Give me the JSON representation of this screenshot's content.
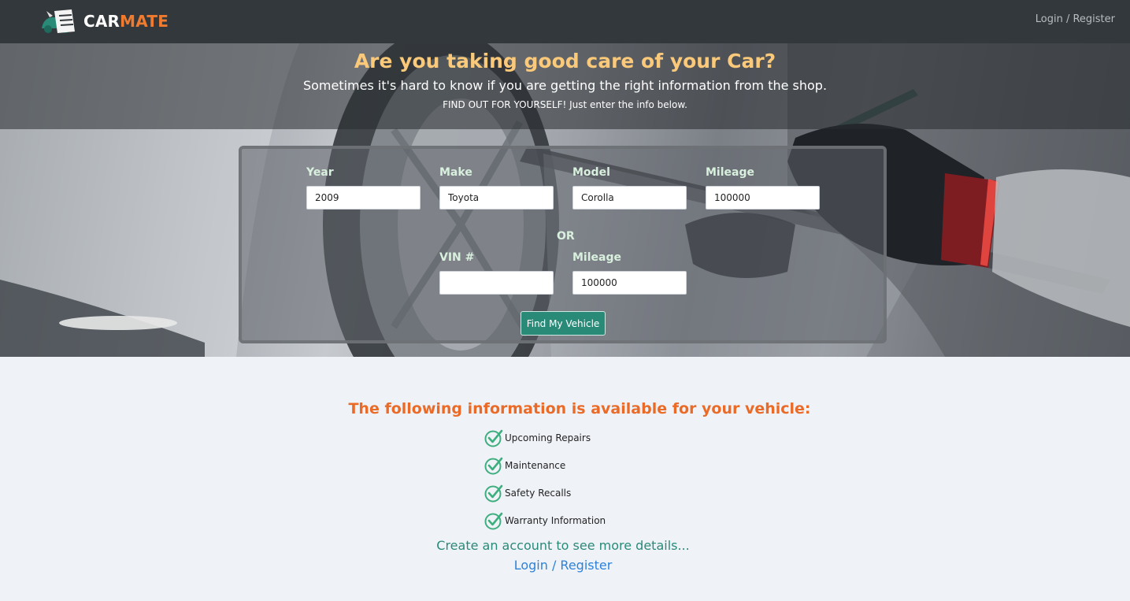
{
  "navbar": {
    "brand_part1": "CAR",
    "brand_part2": "MATE",
    "login_link": "Login / Register"
  },
  "hero": {
    "title": "Are you taking good care of your Car?",
    "subtitle": "Sometimes it's hard to know if you are getting the right information from the shop.",
    "instruction": "FIND OUT FOR YOURSELF! Just enter the info below."
  },
  "form": {
    "year": {
      "label": "Year",
      "value": "2009"
    },
    "make": {
      "label": "Make",
      "value": "Toyota"
    },
    "model": {
      "label": "Model",
      "value": "Corolla"
    },
    "mileage": {
      "label": "Mileage",
      "value": "100000"
    },
    "or_label": "OR",
    "vin": {
      "label": "VIN #",
      "value": ""
    },
    "vin_mileage": {
      "label": "Mileage",
      "value": "100000"
    },
    "submit_label": "Find My Vehicle"
  },
  "info": {
    "title": "The following information is available for your vehicle:",
    "features": [
      "Upcoming Repairs",
      "Maintenance",
      "Safety Recalls",
      "Warranty Information"
    ],
    "cta": "Create an account to see more details...",
    "cta_link": "Login / Register"
  },
  "colors": {
    "navbar_bg": "#33383c",
    "brand_accent": "#f07a2e",
    "hero_title": "#fbc97a",
    "button_bg": "#2a8a78",
    "info_title": "#ea6b28",
    "link": "#2c82d9",
    "check": "#3fae7f"
  },
  "icons": {
    "logo": "carmate-logo-icon",
    "check": "checkmark-circle-icon"
  }
}
